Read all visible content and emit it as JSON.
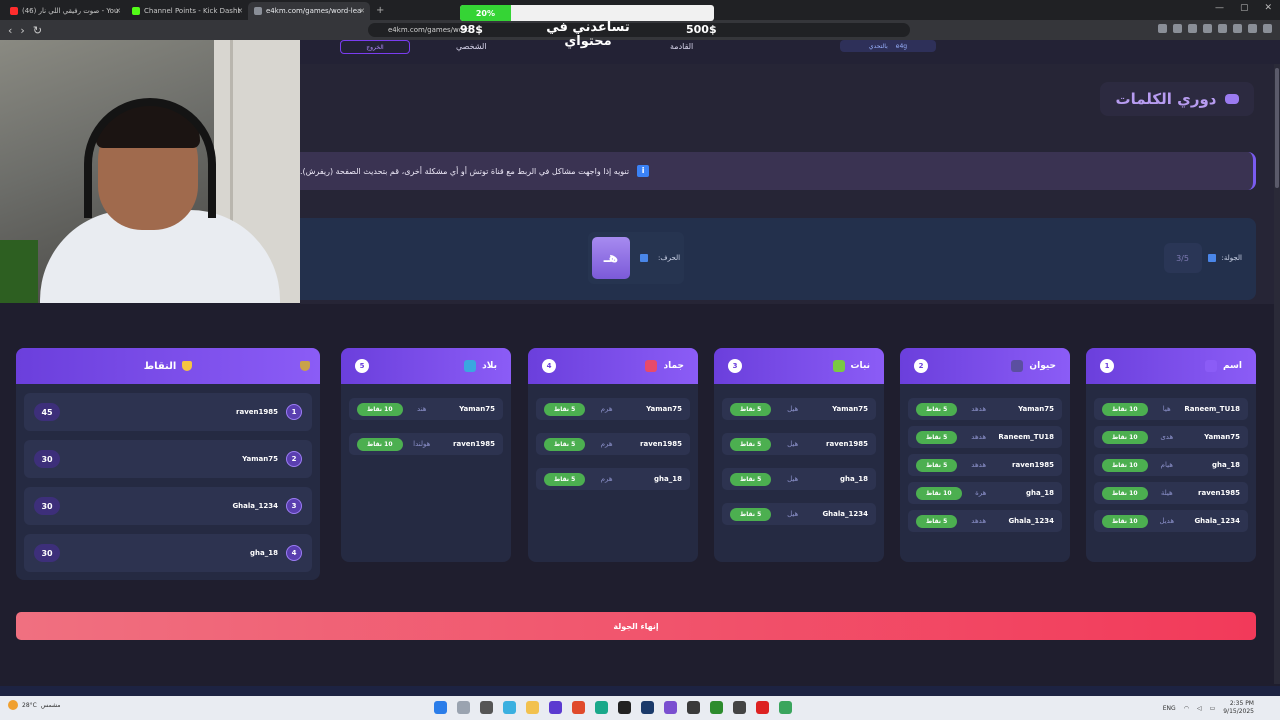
{
  "browser": {
    "tabs": [
      {
        "label": "(46) صوت رفيقي اللي نار - YouTube",
        "color": "#ff2d2d",
        "active": false
      },
      {
        "label": "Channel Points - Kick Dashboard",
        "color": "#53fc18",
        "active": false
      },
      {
        "label": "e4km.com/games/word-league",
        "color": "#8a8f98",
        "active": true
      }
    ],
    "url": "e4km.com/games/word"
  },
  "stream_goal": {
    "percent_label": "20%",
    "progress": 0.2,
    "current": "98$",
    "target": "500$",
    "title": "تساعدني في محتواي"
  },
  "header": {
    "logout": "الخروج",
    "profile": "الشخصي",
    "upcoming": "القادمة",
    "brand_sub": "بالتحدي",
    "brand": "e4g"
  },
  "page": {
    "title": "دوري الكلمات",
    "notice": "تنويه إذا واجهت مشاكل في الربط مع قناة توتش أو أي مشكلة أخرى، قم بتحديث الصفحة (ريفرش).",
    "round_label": "الجولة:",
    "round_value": "3/5",
    "letter_label": "الحرف:",
    "letter": "هـ",
    "end_round": "إنهاء الجولة"
  },
  "categories": [
    {
      "title": "اسم",
      "count": "1",
      "icon_color": "#8b5cf6",
      "rows": [
        {
          "player": "Raneem_TU18",
          "word": "هيا",
          "points": "10 نقاط"
        },
        {
          "player": "Yaman75",
          "word": "هدى",
          "points": "10 نقاط"
        },
        {
          "player": "gha_18",
          "word": "هيام",
          "points": "10 نقاط"
        },
        {
          "player": "raven1985",
          "word": "هيلة",
          "points": "10 نقاط"
        },
        {
          "player": "Ghala_1234",
          "word": "هديل",
          "points": "10 نقاط"
        }
      ]
    },
    {
      "title": "حيوان",
      "count": "2",
      "icon_color": "#5b4fa0",
      "rows": [
        {
          "player": "Yaman75",
          "word": "هدهد",
          "points": "5 نقاط"
        },
        {
          "player": "Raneem_TU18",
          "word": "هدهد",
          "points": "5 نقاط"
        },
        {
          "player": "raven1985",
          "word": "هدهد",
          "points": "5 نقاط"
        },
        {
          "player": "gha_18",
          "word": "هرة",
          "points": "10 نقاط"
        },
        {
          "player": "Ghala_1234",
          "word": "هدهد",
          "points": "5 نقاط"
        }
      ]
    },
    {
      "title": "نبات",
      "count": "3",
      "icon_color": "#7ac943",
      "rows": [
        {
          "player": "Yaman75",
          "word": "هيل",
          "points": "5 نقاط"
        },
        {
          "player": "raven1985",
          "word": "هيل",
          "points": "5 نقاط"
        },
        {
          "player": "gha_18",
          "word": "هيل",
          "points": "5 نقاط"
        },
        {
          "player": "Ghala_1234",
          "word": "هيل",
          "points": "5 نقاط"
        }
      ]
    },
    {
      "title": "جماد",
      "count": "4",
      "icon_color": "#e84a6a",
      "rows": [
        {
          "player": "Yaman75",
          "word": "هرم",
          "points": "5 نقاط"
        },
        {
          "player": "raven1985",
          "word": "هرم",
          "points": "5 نقاط"
        },
        {
          "player": "gha_18",
          "word": "هرم",
          "points": "5 نقاط"
        }
      ]
    },
    {
      "title": "بلاد",
      "count": "5",
      "icon_color": "#3aa7e0",
      "rows": [
        {
          "player": "Yaman75",
          "word": "هند",
          "points": "10 نقاط"
        },
        {
          "player": "raven1985",
          "word": "هولندا",
          "points": "10 نقاط"
        }
      ]
    }
  ],
  "scoreboard": {
    "title": "النقاط",
    "rows": [
      {
        "rank": "1",
        "player": "raven1985",
        "score": "45"
      },
      {
        "rank": "2",
        "player": "Yaman75",
        "score": "30"
      },
      {
        "rank": "3",
        "player": "Ghala_1234",
        "score": "30"
      },
      {
        "rank": "4",
        "player": "gha_18",
        "score": "30"
      }
    ]
  },
  "taskbar": {
    "weather_temp": "28°C",
    "weather_desc": "مشمس",
    "lang": "ENG",
    "time": "2:35 PM",
    "date": "9/15/2025"
  }
}
